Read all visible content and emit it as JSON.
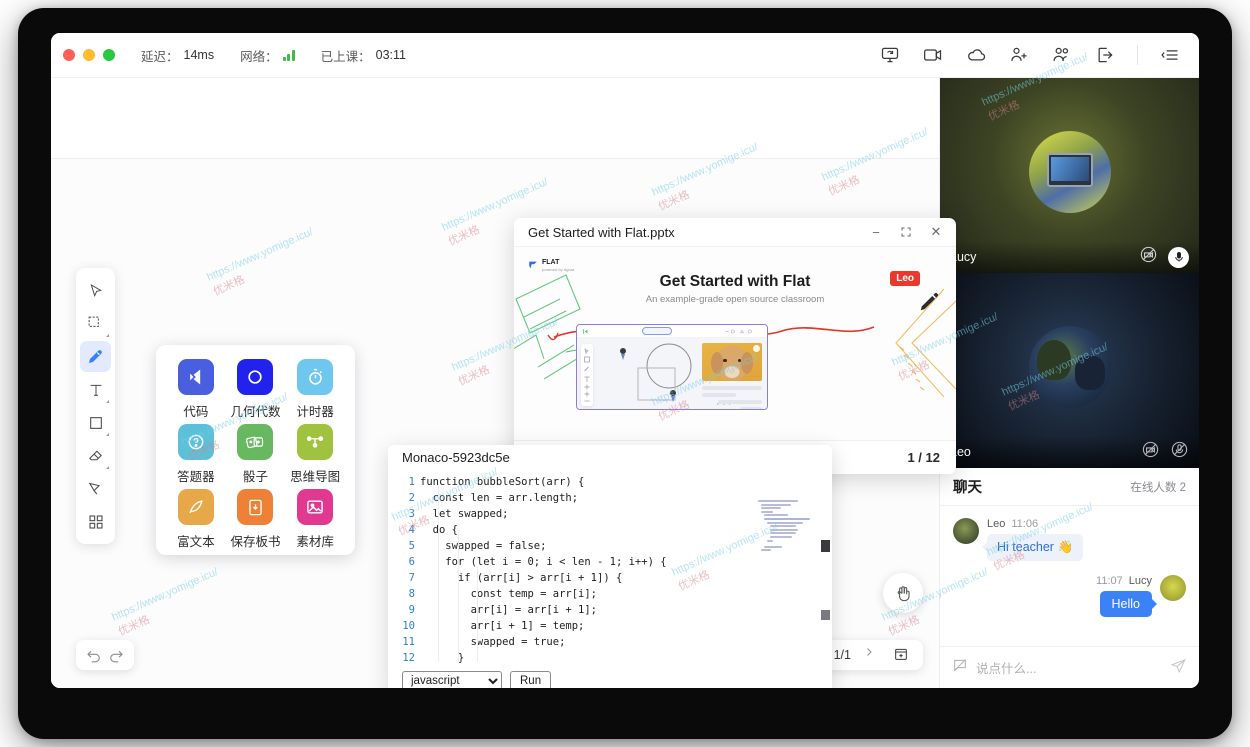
{
  "statusbar": {
    "latency_label": "延迟：",
    "latency_value": "14ms",
    "network_label": "网络：",
    "class_time_label": "已上课：",
    "class_time_value": "03:11"
  },
  "top_icons": [
    {
      "name": "screen-share-icon",
      "glyph": "share"
    },
    {
      "name": "video-camera-icon",
      "glyph": "camera"
    },
    {
      "name": "cloud-storage-icon",
      "glyph": "cloud"
    },
    {
      "name": "invite-user-icon",
      "glyph": "user-plus"
    },
    {
      "name": "user-list-icon",
      "glyph": "users"
    },
    {
      "name": "exit-icon",
      "glyph": "exit"
    },
    {
      "name": "panel-toggle-icon",
      "glyph": "panel"
    }
  ],
  "toolbar": {
    "tools": [
      {
        "name": "select-tool",
        "glyph": "cursor",
        "active": false
      },
      {
        "name": "marquee-select-tool",
        "glyph": "marquee",
        "active": false
      },
      {
        "name": "pencil-tool",
        "glyph": "pencil",
        "active": true
      },
      {
        "name": "text-tool",
        "glyph": "text",
        "active": false
      },
      {
        "name": "shape-tool",
        "glyph": "square",
        "active": false
      },
      {
        "name": "eraser-tool",
        "glyph": "eraser",
        "active": false
      },
      {
        "name": "clear-tool",
        "glyph": "clear",
        "active": false
      },
      {
        "name": "apps-tool",
        "glyph": "grid",
        "active": false
      }
    ]
  },
  "apps_panel": {
    "items": [
      {
        "label": "代码",
        "icon": "code-icon",
        "color": "#4a5fe0"
      },
      {
        "label": "几何代数",
        "icon": "geogebra-icon",
        "color": "#2222ee"
      },
      {
        "label": "计时器",
        "icon": "timer-icon",
        "color": "#6fc7ef"
      },
      {
        "label": "答题器",
        "icon": "quiz-icon",
        "color": "#5bc0d8"
      },
      {
        "label": "骰子",
        "icon": "dice-icon",
        "color": "#67b85e"
      },
      {
        "label": "思维导图",
        "icon": "mindmap-icon",
        "color": "#9fc23f"
      },
      {
        "label": "富文本",
        "icon": "richtext-icon",
        "color": "#e8a84a"
      },
      {
        "label": "保存板书",
        "icon": "save-board-icon",
        "color": "#ef8136"
      },
      {
        "label": "素材库",
        "icon": "asset-library-icon",
        "color": "#e0398f"
      }
    ]
  },
  "pptx_window": {
    "title": "Get Started with Flat.pptx",
    "minimize_label": "−",
    "maximize_label": "⛶",
    "close_label": "✕",
    "slide": {
      "logo_main": "FLAT",
      "logo_sub": "powered by Agora",
      "title": "Get Started with Flat",
      "subtitle": "An example-grade open source classroom",
      "badge": "Leo"
    },
    "page_indicator": "1 / 12"
  },
  "code_window": {
    "title": "Monaco-5923dc5e",
    "language": "javascript",
    "language_options": [
      "javascript"
    ],
    "run_label": "Run",
    "lines": [
      {
        "n": "1",
        "text": "function bubbleSort(arr) {"
      },
      {
        "n": "2",
        "text": "  const len = arr.length;"
      },
      {
        "n": "3",
        "text": "  let swapped;"
      },
      {
        "n": "4",
        "text": "  do {"
      },
      {
        "n": "5",
        "text": "    swapped = false;"
      },
      {
        "n": "6",
        "text": "    for (let i = 0; i < len - 1; i++) {"
      },
      {
        "n": "7",
        "text": "      if (arr[i] > arr[i + 1]) {"
      },
      {
        "n": "8",
        "text": "        const temp = arr[i];"
      },
      {
        "n": "9",
        "text": "        arr[i] = arr[i + 1];"
      },
      {
        "n": "10",
        "text": "        arr[i + 1] = temp;"
      },
      {
        "n": "11",
        "text": "        swapped = true;"
      },
      {
        "n": "12",
        "text": "      }"
      }
    ]
  },
  "board_controls": {
    "undo_label": "undo-icon",
    "redo_label": "redo-icon",
    "page_indicator": "1/1",
    "add_page_label": "add-page-icon",
    "hand_label": "hand-icon"
  },
  "sidebar": {
    "videos": [
      {
        "name": "Lucy",
        "camera_off": true,
        "mic_on": true
      },
      {
        "name": "Leo",
        "camera_off": true,
        "mic_off": true
      }
    ],
    "chat": {
      "title": "聊天",
      "online_count": "在线人数 2",
      "messages": [
        {
          "sender": "Leo",
          "time": "11:06",
          "text": "Hi teacher 👋",
          "side": "in"
        },
        {
          "sender": "Lucy",
          "time": "11:07",
          "text": "Hello",
          "side": "out"
        }
      ],
      "input_placeholder": "说点什么...",
      "send_label": "send-icon"
    }
  },
  "watermarks": [
    {
      "top": "https://www.yomige.icu/",
      "bottom": "优米格"
    }
  ]
}
